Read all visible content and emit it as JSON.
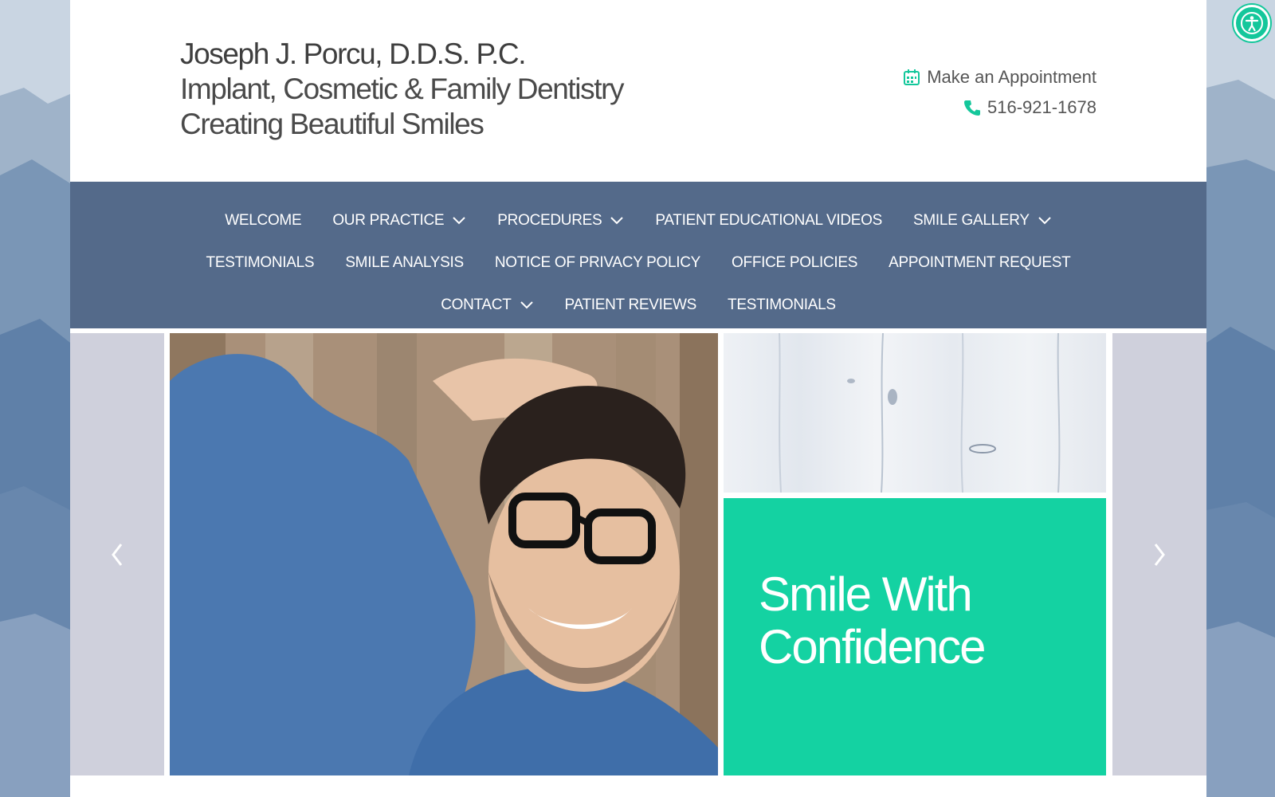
{
  "brand": {
    "name": "Joseph J. Porcu, D.D.S. P.C.",
    "specialty": "Implant, Cosmetic & Family Dentistry",
    "tagline": "Creating Beautiful Smiles"
  },
  "contact": {
    "appointment_label": "Make an Appointment",
    "appointment_icon": "calendar-icon",
    "phone": "516-921-1678",
    "phone_icon": "phone-icon"
  },
  "nav": {
    "row1": [
      {
        "label": "WELCOME",
        "dropdown": false
      },
      {
        "label": "OUR PRACTICE",
        "dropdown": true
      },
      {
        "label": "PROCEDURES",
        "dropdown": true
      },
      {
        "label": "PATIENT EDUCATIONAL VIDEOS",
        "dropdown": false
      },
      {
        "label": "SMILE GALLERY",
        "dropdown": true
      }
    ],
    "row2": [
      {
        "label": "TESTIMONIALS",
        "dropdown": false
      },
      {
        "label": "SMILE ANALYSIS",
        "dropdown": false
      },
      {
        "label": "NOTICE OF PRIVACY POLICY",
        "dropdown": false
      },
      {
        "label": "OFFICE POLICIES",
        "dropdown": false
      },
      {
        "label": "APPOINTMENT REQUEST",
        "dropdown": false
      }
    ],
    "row3": [
      {
        "label": "CONTACT",
        "dropdown": true
      },
      {
        "label": "PATIENT REVIEWS",
        "dropdown": false
      },
      {
        "label": "TESTIMONIALS",
        "dropdown": false
      }
    ]
  },
  "slider": {
    "headline": "Smile With Confidence",
    "headline_line1": "Smile With",
    "headline_line2": "Confidence",
    "prev_icon": "chevron-left-icon",
    "next_icon": "chevron-right-icon"
  },
  "colors": {
    "accent": "#14d2a2",
    "nav_bg": "#546a8a",
    "side_panel": "#cfd0dc"
  },
  "accessibility": {
    "icon": "accessibility-icon"
  }
}
